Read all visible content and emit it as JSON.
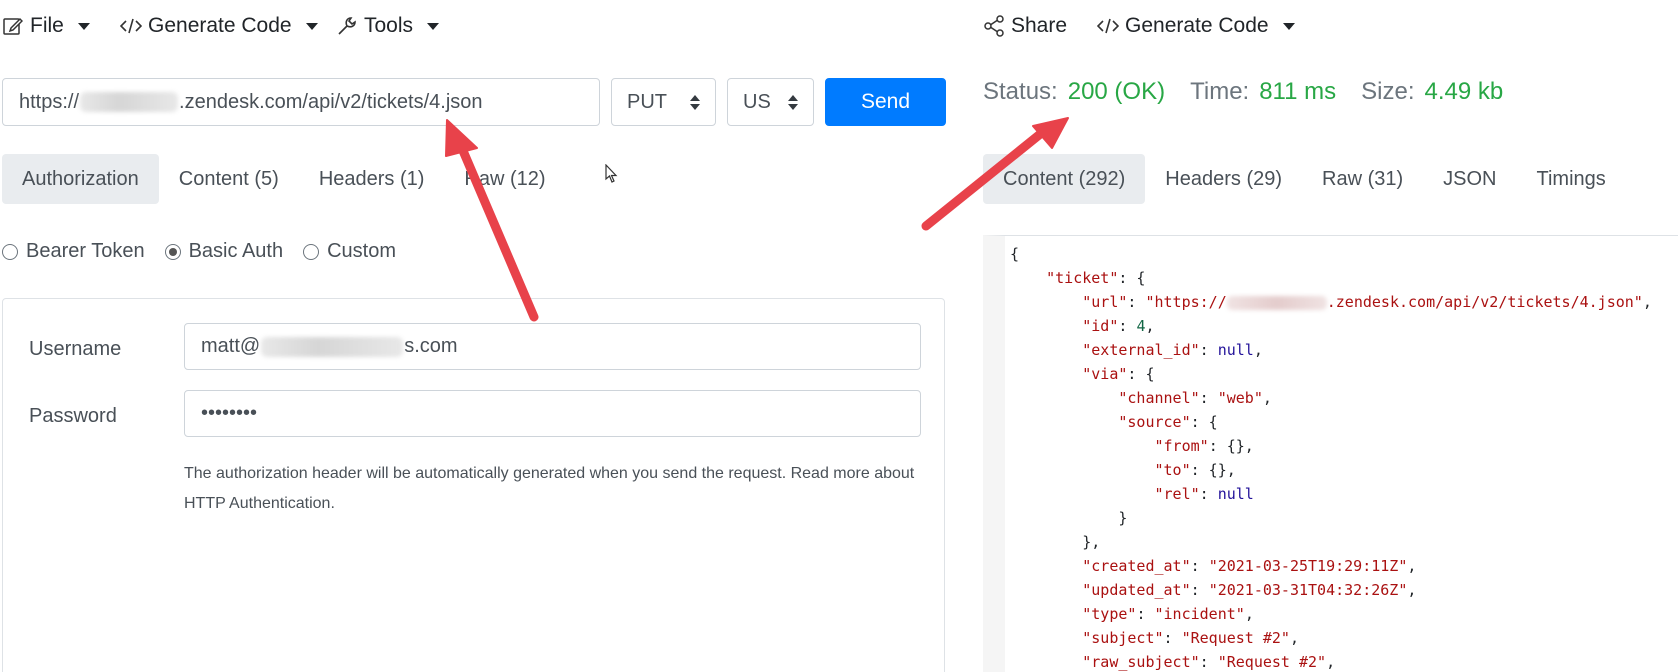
{
  "toolbar_left": {
    "file": "File",
    "generate_code": "Generate Code",
    "tools": "Tools"
  },
  "toolbar_right": {
    "share": "Share",
    "generate_code": "Generate Code"
  },
  "request": {
    "url_prefix": "https://",
    "url_suffix": ".zendesk.com/api/v2/tickets/4.json",
    "method": "PUT",
    "region": "US",
    "send_label": "Send"
  },
  "request_tabs": [
    "Authorization",
    "Content (5)",
    "Headers (1)",
    "Raw (12)"
  ],
  "auth": {
    "options": [
      "Bearer Token",
      "Basic Auth",
      "Custom"
    ],
    "selected": "Basic Auth",
    "username_label": "Username",
    "username_prefix": "matt@",
    "username_suffix": "s.com",
    "password_label": "Password",
    "password_value": "••••••••",
    "help_text": "The authorization header will be automatically generated when you send the request. Read more about HTTP Authentication."
  },
  "response": {
    "status_label": "Status:",
    "status_value": "200 (OK)",
    "time_label": "Time:",
    "time_value": "811 ms",
    "size_label": "Size:",
    "size_value": "4.49 kb",
    "accent_color": "#28a745"
  },
  "response_tabs": [
    "Content (292)",
    "Headers (29)",
    "Raw (31)",
    "JSON",
    "Timings"
  ],
  "json": {
    "open_brace": "{",
    "ticket_key": "\"ticket\"",
    "url_key": "\"url\"",
    "url_prefix": "\"https://",
    "url_suffix": ".zendesk.com/api/v2/tickets/4.json\"",
    "id_key": "\"id\"",
    "id_val": "4",
    "external_id_key": "\"external_id\"",
    "null": "null",
    "via_key": "\"via\"",
    "channel_key": "\"channel\"",
    "channel_val": "\"web\"",
    "source_key": "\"source\"",
    "from_key": "\"from\"",
    "to_key": "\"to\"",
    "rel_key": "\"rel\"",
    "created_key": "\"created_at\"",
    "created_val": "\"2021-03-25T19:29:11Z\"",
    "updated_key": "\"updated_at\"",
    "updated_val": "\"2021-03-31T04:32:26Z\"",
    "type_key": "\"type\"",
    "type_val": "\"incident\"",
    "subject_key": "\"subject\"",
    "subject_val": "\"Request #2\"",
    "raw_subject_key": "\"raw_subject\"",
    "raw_subject_val": "\"Request #2\""
  },
  "icons": {
    "file": "edit-icon",
    "code": "code-icon",
    "tools": "wrench-icon",
    "share": "share-icon",
    "annotation_color": "#e8424a"
  }
}
